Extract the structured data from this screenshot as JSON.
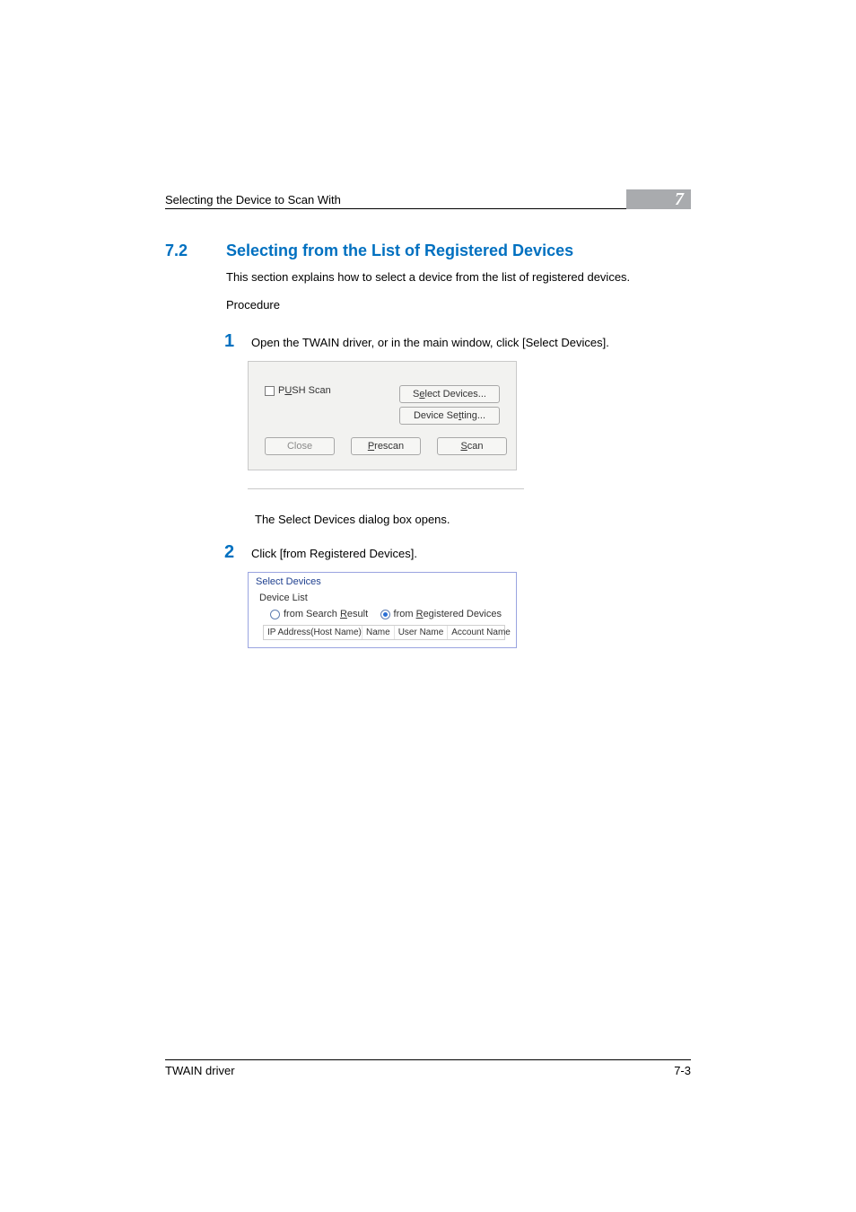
{
  "header": {
    "running_title": "Selecting the Device to Scan With",
    "chapter_number": "7"
  },
  "section": {
    "number": "7.2",
    "title": "Selecting from the List of Registered Devices",
    "lead": "This section explains how to select a device from the list of registered devices.",
    "procedure_label": "Procedure"
  },
  "steps": {
    "s1_num": "1",
    "s1_text": "Open the TWAIN driver, or in the main window, click [Select Devices].",
    "s1_after": "The Select Devices dialog box opens.",
    "s2_num": "2",
    "s2_text": "Click [from Registered Devices]."
  },
  "figure1": {
    "push_prefix": "P",
    "push_underline": "U",
    "push_suffix": "SH Scan",
    "select_prefix": "S",
    "select_underline": "e",
    "select_suffix": "lect Devices...",
    "setting_prefix": "Device Se",
    "setting_underline": "t",
    "setting_suffix": "ting...",
    "close": "Close",
    "prescan_underline": "P",
    "prescan_suffix": "rescan",
    "scan_underline": "S",
    "scan_suffix": "can"
  },
  "figure2": {
    "title": "Select Devices",
    "group_label": "Device List",
    "radio1_prefix": "from Search ",
    "radio1_underline": "R",
    "radio1_suffix": "esult",
    "radio2_prefix": "from ",
    "radio2_underline": "R",
    "radio2_suffix": "egistered Devices",
    "col_a": "IP Address(Host Name)",
    "col_b": "Name",
    "col_c": "User Name",
    "col_d": "Account Name"
  },
  "footer": {
    "left": "TWAIN driver",
    "right": "7-3"
  }
}
